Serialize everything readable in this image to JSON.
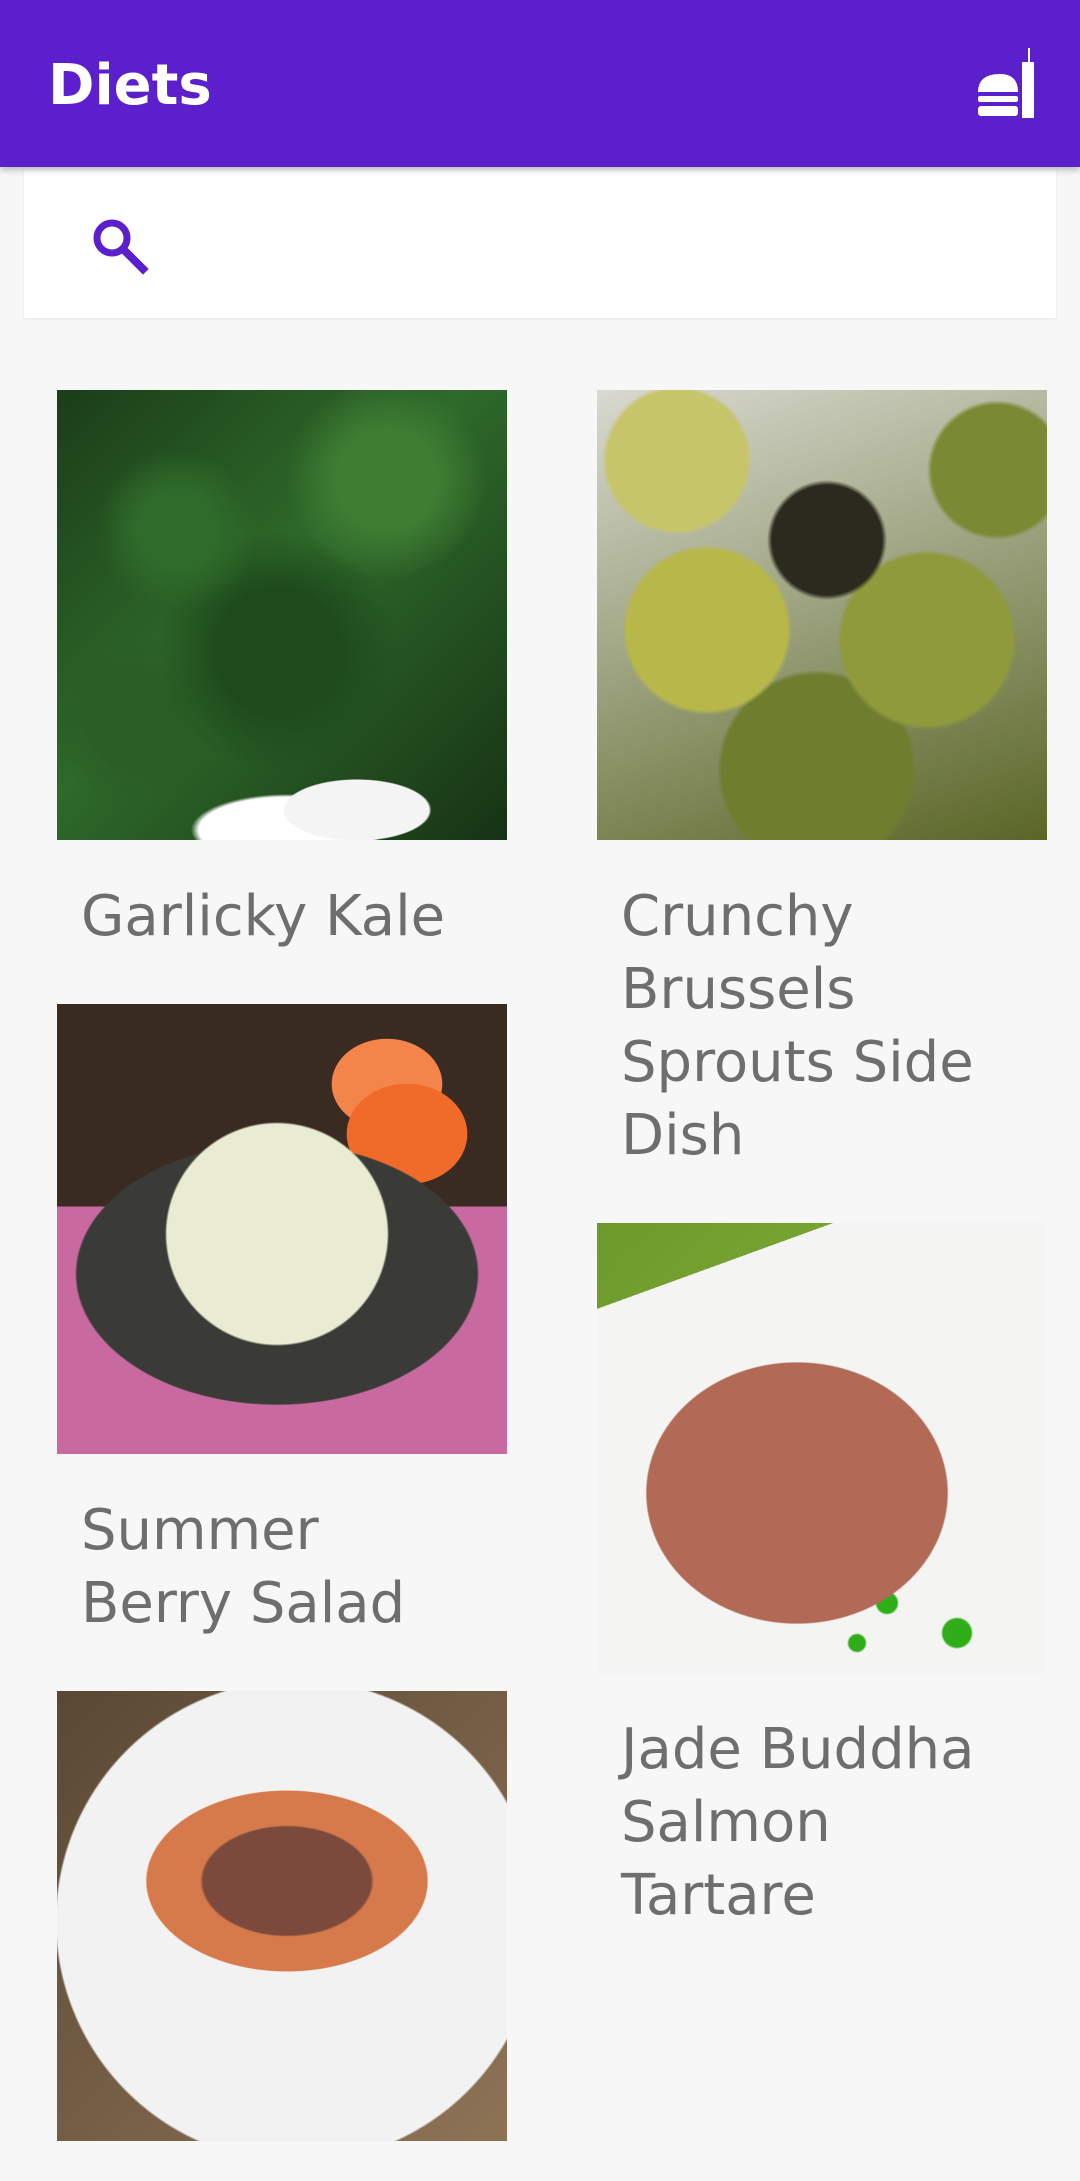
{
  "app": {
    "title": "Diets",
    "menu_icon": "fastfood-icon",
    "colors": {
      "primary": "#5b1fcb",
      "background": "#f7f7f7",
      "card_text": "#6e6e6e"
    }
  },
  "search": {
    "icon": "search-icon",
    "value": "",
    "placeholder": ""
  },
  "recipes": [
    {
      "name": "Garlicky Kale"
    },
    {
      "name": "Crunchy Brussels Sprouts Side Dish"
    },
    {
      "name": "Summer Berry Salad"
    },
    {
      "name": "Jade Buddha Salmon Tartare"
    },
    {
      "name": ""
    }
  ]
}
